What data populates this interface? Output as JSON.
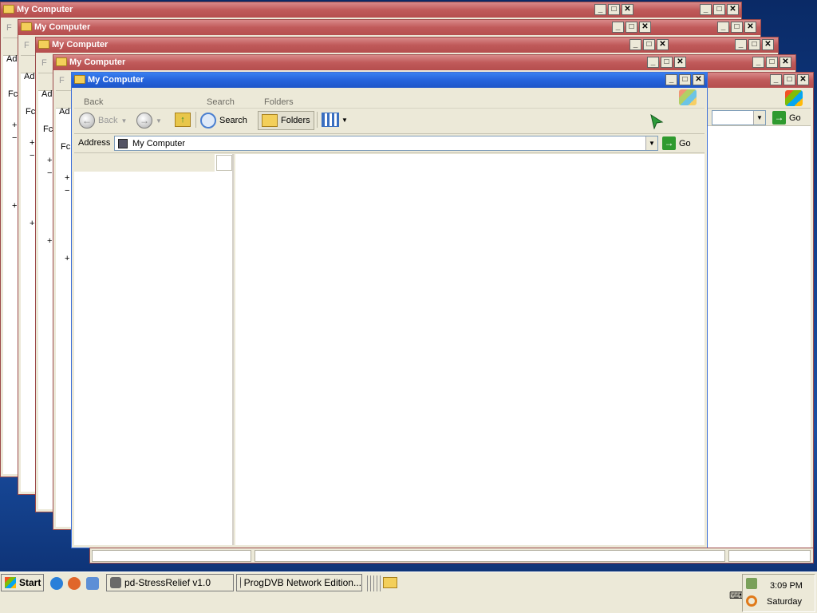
{
  "windows": [
    {
      "title": "My Computer",
      "stub_label": "F",
      "addr_stub": "Ad",
      "fold_stub": "Fc"
    },
    {
      "title": "My Computer",
      "stub_label": "F",
      "addr_stub": "Ad",
      "fold_stub": "Fc"
    },
    {
      "title": "My Computer",
      "stub_label": "F",
      "addr_stub": "Ad",
      "fold_stub": "Fc"
    },
    {
      "title": "My Computer",
      "stub_label": "F",
      "addr_stub": "Ad",
      "fold_stub": "Fc"
    }
  ],
  "ghost_toolbar": {
    "back": "Back",
    "search": "Search",
    "folders": "Folders"
  },
  "active": {
    "title": "My Computer",
    "toolbar": {
      "back": "Back",
      "search": "Search",
      "folders": "Folders"
    },
    "address_label": "Address",
    "address_value": "My Computer",
    "go_label": "Go"
  },
  "background_go_label": "Go",
  "tree_marks": [
    "+",
    "−",
    "+"
  ],
  "taskbar": {
    "start_label": "Start",
    "tasks": [
      "pd-StressRelief v1.0",
      "ProgDVB Network Edition..."
    ],
    "clock": "3:09 PM",
    "day": "Saturday"
  },
  "caption_buttons": {
    "minimize": "_",
    "maximize": "□",
    "close": "✕"
  }
}
